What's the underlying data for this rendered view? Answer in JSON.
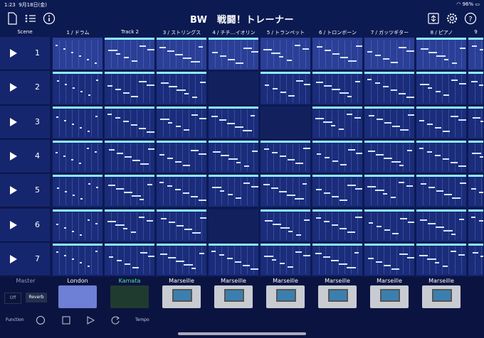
{
  "status": {
    "time": "1:23",
    "date": "9月18日(金)",
    "battery": "96%"
  },
  "title": "BW　戦闘！トレーナー",
  "columns": {
    "scene": "Scene",
    "tracks": [
      "1 / ドラム",
      "Track 2",
      "3 / ストリングス",
      "4 / チチ…イオリン",
      "5 / トランペット",
      "6 / トロンボーン",
      "7 / ガッツギター",
      "8 / ピアノ",
      "9"
    ]
  },
  "scenes": [
    "1",
    "2",
    "3",
    "4",
    "5",
    "6",
    "7"
  ],
  "devices": {
    "master": "Master",
    "off": "Off",
    "reverb": "Reverb",
    "names": [
      "London",
      "Kamata",
      "Marseille",
      "Marseille",
      "Marseille",
      "Marseille",
      "Marseille",
      "Marseille"
    ]
  },
  "transport": {
    "function": "Function",
    "tempo": "Tempo"
  },
  "colors": {
    "cellbar": "#8ff2ff",
    "kamata": "#59e0a0"
  }
}
